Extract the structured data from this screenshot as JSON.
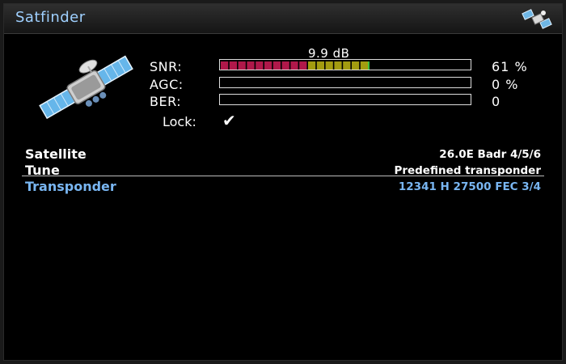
{
  "window": {
    "title": "Satfinder"
  },
  "icons": {
    "title": "satellite-icon",
    "main": "satellite-icon",
    "lock": "check-icon"
  },
  "colors": {
    "title": "#9fd0ff",
    "snr_red": "#b0184a",
    "snr_yellow": "#a39c10",
    "selected": "#79b6f2"
  },
  "signal": {
    "snr_db_label": "9.9 dB",
    "snr": {
      "label": "SNR:",
      "value": 61,
      "percent_text": "61 %"
    },
    "agc": {
      "label": "AGC:",
      "value": 0,
      "percent_text": "0 %"
    },
    "ber": {
      "label": "BER:",
      "value": 0,
      "value_text": "0"
    },
    "lock": {
      "label": "Lock:",
      "locked": true,
      "glyph": "✔"
    }
  },
  "settings": [
    {
      "label": "Satellite",
      "value": "26.0E Badr 4/5/6"
    },
    {
      "label": "Tune",
      "value": "Predefined transponder"
    },
    {
      "label": "Transponder",
      "value": "12341 H 27500 FEC 3/4",
      "selected": true
    }
  ]
}
